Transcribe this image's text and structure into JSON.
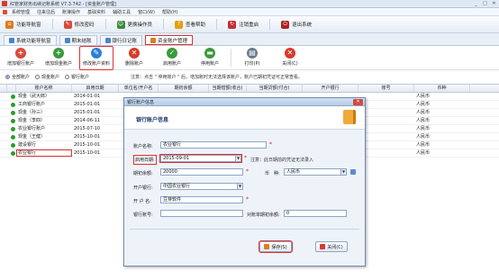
{
  "window": {
    "title": "红管家财务出纳记账系统 V7.3.742 - [资金账户管理]",
    "controls": [
      "_",
      "□",
      "✕"
    ]
  },
  "menu": [
    "系统管理",
    "往来往后",
    "账簿操作",
    "基础资料",
    "辅助工具",
    "窗口(W)",
    "帮助(H)"
  ],
  "quickbar": {
    "items": [
      {
        "label": "功能导航窗",
        "color": "#e07b1f",
        "glyph": "⌂",
        "icon": "home-icon"
      },
      {
        "label": "修改密码",
        "color": "#d84a3a",
        "glyph": "✎",
        "icon": "key-icon"
      },
      {
        "label": "更换操作员",
        "color": "#3a8a3a",
        "glyph": "☺",
        "icon": "user-icon"
      },
      {
        "label": "查看帮助",
        "color": "#e5a00d",
        "glyph": "?",
        "icon": "help-icon"
      },
      {
        "label": "注销重启",
        "color": "#c03030",
        "glyph": "↻",
        "icon": "restart-icon"
      },
      {
        "label": "退出系统",
        "color": "#b02020",
        "glyph": "⏻",
        "icon": "power-icon"
      }
    ]
  },
  "tabs": [
    {
      "label": "系统功能导航窗",
      "active": false,
      "color": "#4a86c8"
    },
    {
      "label": "期末结账",
      "active": false,
      "color": "#4a86c8"
    },
    {
      "label": "银行日记账",
      "active": false,
      "color": "#4a86c8"
    },
    {
      "label": "资金账户管理",
      "active": true,
      "color": "#e07b1f"
    }
  ],
  "toolbar": [
    {
      "label": "增加银行账户",
      "color": "#d84a3a",
      "glyph": "+",
      "icon": "add-bank-icon"
    },
    {
      "label": "增加现金账户",
      "color": "#3a9a3a",
      "glyph": "+",
      "icon": "add-cash-icon"
    },
    {
      "label": "修改账户资料",
      "color": "#2a7fd6",
      "glyph": "✎",
      "icon": "edit-icon",
      "highlighted": true
    },
    {
      "label": "删除账户",
      "color": "#d83a2a",
      "glyph": "✕",
      "icon": "delete-icon"
    },
    {
      "label": "启用账户",
      "color": "#3a9a3a",
      "glyph": "✓",
      "icon": "enable-icon"
    },
    {
      "label": "停用账户",
      "color": "#3a9a3a",
      "glyph": "▬",
      "icon": "disable-icon"
    },
    {
      "label": "打印(P)",
      "color": "#6a7a8c",
      "glyph": "▤",
      "icon": "printer-icon"
    },
    {
      "label": "关闭(C)",
      "color": "#d83a2a",
      "glyph": "✕",
      "icon": "close-icon"
    }
  ],
  "filter": {
    "options": [
      "全部账户",
      "现金账户",
      "银行账户"
    ],
    "selected": 0,
    "note": "注意：点击 \" 停用账户 \" 后，增加账时无法选择该账户，账户已期初凭证可正常查看。"
  },
  "grid": {
    "headers": [
      "",
      "",
      "账户名称",
      "启用日期",
      "单位名/开户名",
      "期初余额",
      "当期借额(收合)",
      "当期贷额(付合)",
      "开户银行",
      "账号",
      "币种"
    ],
    "rows": [
      {
        "name": "现金（武大郎）",
        "date": "2014-01-01",
        "currency": "人民币"
      },
      {
        "name": "工商银行账户",
        "date": "2015-01-01",
        "currency": "人民币"
      },
      {
        "name": "现金（孙三）",
        "date": "2015-01-01",
        "currency": "人民币"
      },
      {
        "name": "现金（李四）",
        "date": "2014-06-11",
        "currency": "人民币"
      },
      {
        "name": "农业银行账户",
        "date": "2015-07-10",
        "currency": "人民币"
      },
      {
        "name": "现金（王健）",
        "date": "2015-10-01",
        "currency": "人民币"
      },
      {
        "name": "建设银行",
        "date": "2015-10-01",
        "currency": "人民币"
      },
      {
        "name": "农业银行",
        "date": "2015-10-01",
        "currency": "人民币",
        "highlighted": true
      }
    ]
  },
  "dialog": {
    "title": "银行账户信息",
    "close": "✕",
    "header": "银行账户信息",
    "fields": {
      "account_name": {
        "label": "账户名称:",
        "value": "农业银行"
      },
      "start_date": {
        "label": "启用日期:",
        "value": "2015-09-01"
      },
      "start_hint": "注意：此日期前的凭证无法录入",
      "opening_balance": {
        "label": "期初余额:",
        "value": "20000"
      },
      "currency": {
        "label": "币　种:",
        "value": "人民币"
      },
      "bank": {
        "label": "开户银行:",
        "value": "中国农业银行"
      },
      "holder": {
        "label": "开 户 名:",
        "value": "豆芽软件"
      },
      "account_no": {
        "label": "银行账号:",
        "value": ""
      },
      "unreconciled": {
        "label": "对账单期初余额:",
        "value": "0"
      }
    },
    "buttons": {
      "save": "保存(S)",
      "close": "关闭(C)"
    }
  }
}
